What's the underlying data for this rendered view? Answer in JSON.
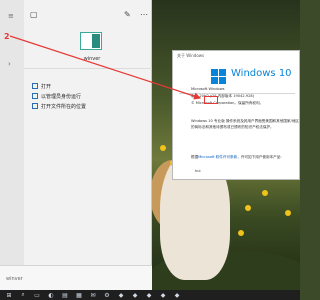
{
  "start_menu": {
    "rail_icons": [
      "hamburger-icon",
      "chevron-right-icon"
    ],
    "top_icons": [
      "document-icon",
      "pin-icon",
      "more-icon",
      "close-icon"
    ],
    "app_name": "winver",
    "items": [
      {
        "label": "打开",
        "icon": "open-icon"
      },
      {
        "label": "以管理员身份运行",
        "icon": "shield-icon"
      },
      {
        "label": "打开文件所在的位置",
        "icon": "folder-icon"
      }
    ],
    "search_placeholder": "winver"
  },
  "annotation": {
    "label": "2",
    "color": "#e53935"
  },
  "about_window": {
    "title": "关于 Windows",
    "logo_text": "Windows 10",
    "lines": [
      "Microsoft Windows",
      "版本 20H2 (OS 内部版本 19042.928)",
      "© Microsoft Corporation。保留所有权利。"
    ],
    "body_lines": [
      "Windows 10 专业版 操作系统及其用户界面受美国和其他国家/地区",
      "的商标法和其他待颁布或已颁布的知识产权法保护。"
    ],
    "license_prefix": "根据",
    "license_link": "Microsoft 软件许可条款",
    "license_suffix": "，许可如下用户使用本产品:",
    "user": "hui"
  },
  "taskbar": {
    "items": [
      "start-icon",
      "search-icon",
      "task-view-icon",
      "edge-icon",
      "explorer-icon",
      "store-icon",
      "mail-icon",
      "settings-icon",
      "app-icon",
      "app-icon",
      "app-icon",
      "app-icon",
      "app-icon"
    ]
  },
  "colors": {
    "accent": "#0a84d8",
    "annotation": "#e53935"
  }
}
